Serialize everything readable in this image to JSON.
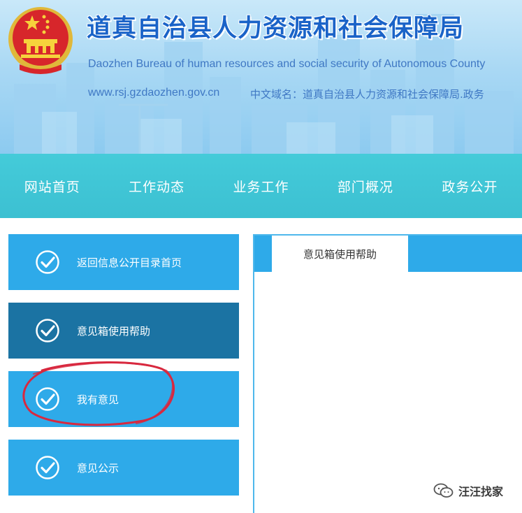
{
  "header": {
    "title": "道真自治县人力资源和社会保障局",
    "subtitle": "Daozhen Bureau of human resources and social security of Autonomous County",
    "url": "www.rsj.gzdaozhen.gov.cn",
    "cn_domain": "中文域名：道真自治县人力资源和社会保障局.政务",
    "emblem_icon": "national-emblem-icon"
  },
  "nav": {
    "items": [
      {
        "label": "网站首页"
      },
      {
        "label": "工作动态"
      },
      {
        "label": "业务工作"
      },
      {
        "label": "部门概况"
      },
      {
        "label": "政务公开"
      }
    ]
  },
  "sidebar": {
    "items": [
      {
        "label": "返回信息公开目录首页",
        "icon": "check-circle-icon",
        "active": false
      },
      {
        "label": "意见箱使用帮助",
        "icon": "check-circle-icon",
        "active": true
      },
      {
        "label": "我有意见",
        "icon": "check-circle-icon",
        "active": false
      },
      {
        "label": "意见公示",
        "icon": "check-circle-icon",
        "active": false
      }
    ]
  },
  "panel": {
    "active_tab": "意见箱使用帮助"
  },
  "watermark": {
    "text": "汪汪找家",
    "icon": "wechat-icon"
  },
  "colors": {
    "title_blue": "#1a63c8",
    "nav_teal": "#3cc0d2",
    "sidebar_blue": "#2eaae9",
    "sidebar_active": "#1b73a3",
    "annotation_red": "#d8283f"
  }
}
